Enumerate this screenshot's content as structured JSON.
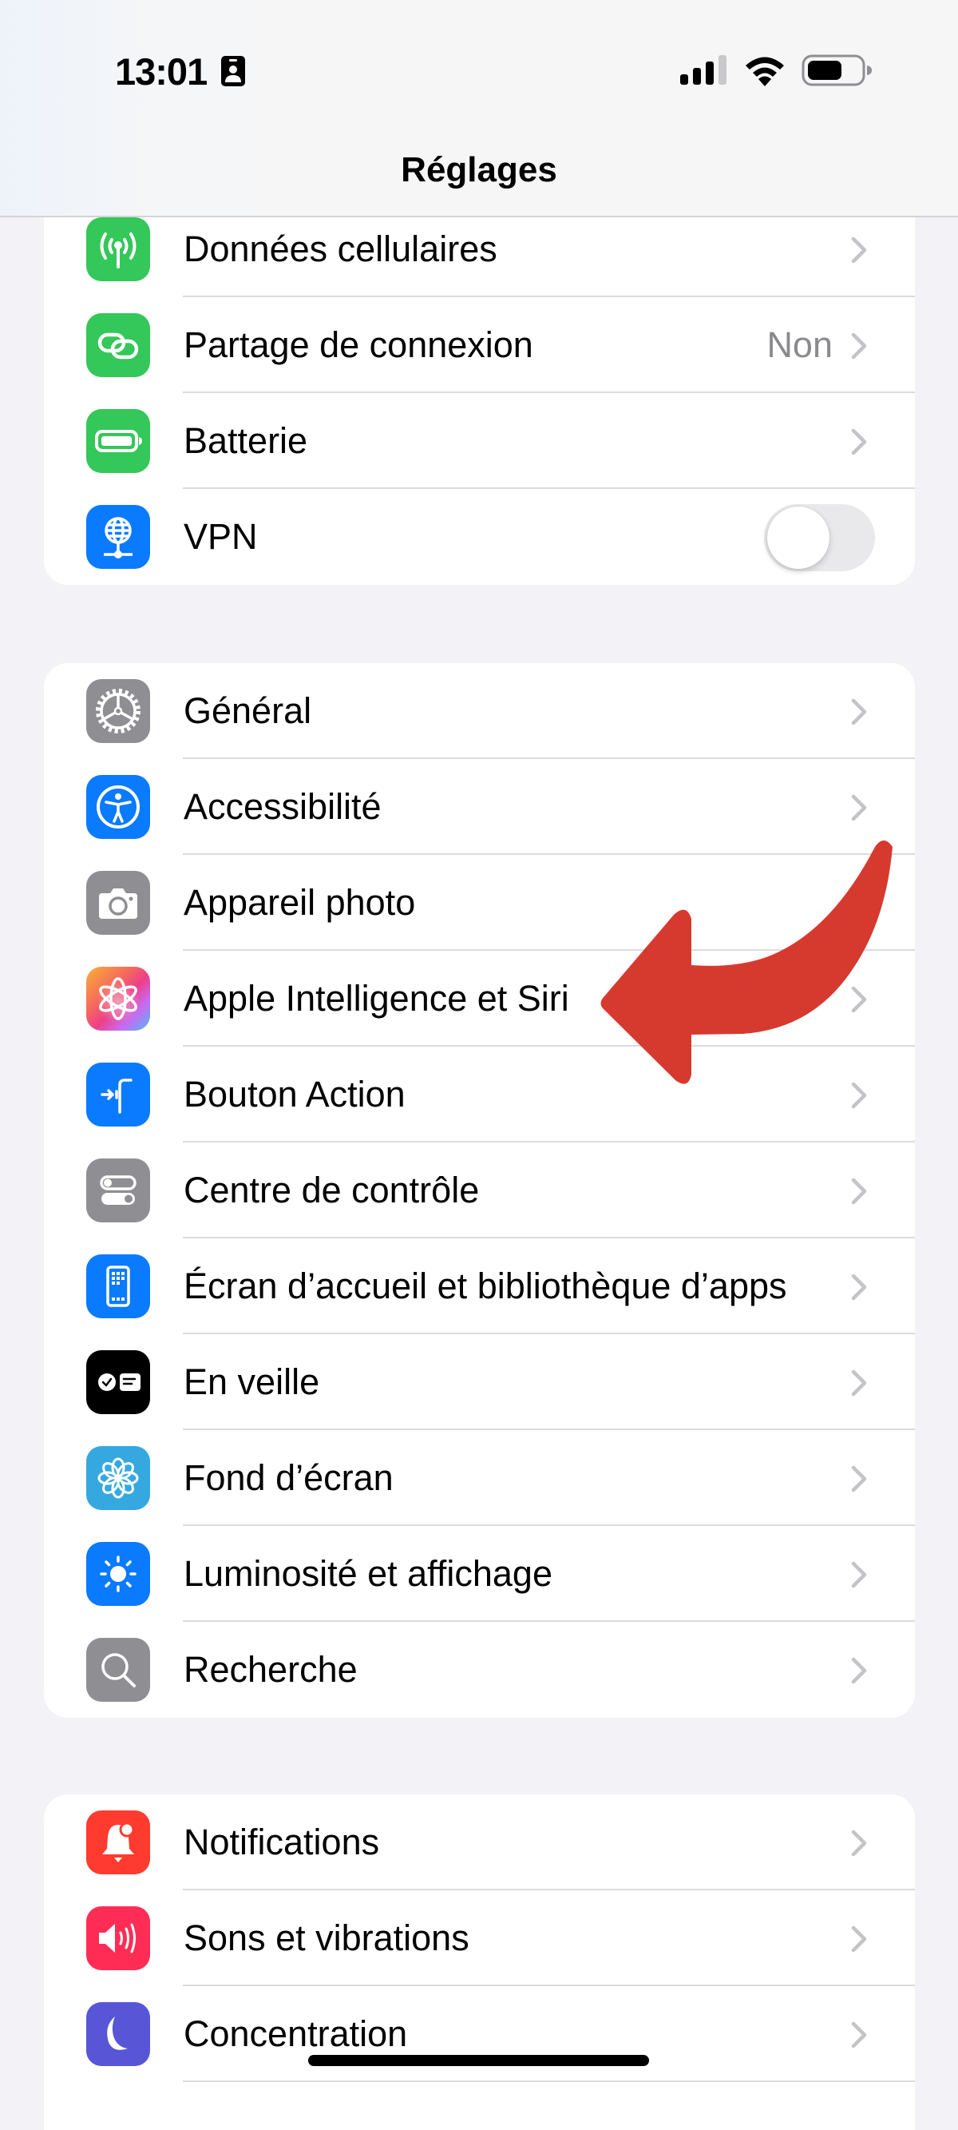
{
  "status_bar": {
    "time": "13:01",
    "status_icon": "id-badge-icon",
    "signal_bars": 3,
    "signal_bars_total": 4,
    "battery_percent": 60
  },
  "header": {
    "title": "Réglages"
  },
  "groups": [
    {
      "rows": [
        {
          "label": "Données cellulaires",
          "icon": "antenna-icon",
          "icon_color": "#34c759",
          "accessory": "chevron"
        },
        {
          "label": "Partage de connexion",
          "icon": "link-icon",
          "icon_color": "#34c759",
          "value": "Non",
          "accessory": "chevron"
        },
        {
          "label": "Batterie",
          "icon": "battery-icon",
          "icon_color": "#34c759",
          "accessory": "chevron"
        },
        {
          "label": "VPN",
          "icon": "globe-network-icon",
          "icon_color": "#0a7aff",
          "accessory": "toggle",
          "toggle_on": false
        }
      ]
    },
    {
      "rows": [
        {
          "label": "Général",
          "icon": "gear-icon",
          "icon_color": "#8e8e93",
          "accessory": "chevron"
        },
        {
          "label": "Accessibilité",
          "icon": "accessibility-icon",
          "icon_color": "#0a7aff",
          "accessory": "chevron"
        },
        {
          "label": "Appareil photo",
          "icon": "camera-icon",
          "icon_color": "#8e8e93",
          "accessory": "chevron"
        },
        {
          "label": "Apple Intelligence et Siri",
          "icon": "apple-intelligence-icon",
          "icon_color": "gradient",
          "accessory": "chevron"
        },
        {
          "label": "Bouton Action",
          "icon": "action-button-icon",
          "icon_color": "#0a7aff",
          "accessory": "chevron"
        },
        {
          "label": "Centre de contrôle",
          "icon": "switches-icon",
          "icon_color": "#8e8e93",
          "accessory": "chevron"
        },
        {
          "label": "Écran d’accueil et bibliothèque d’apps",
          "icon": "home-screen-icon",
          "icon_color": "#0a7aff",
          "accessory": "chevron"
        },
        {
          "label": "En veille",
          "icon": "standby-icon",
          "icon_color": "#000000",
          "accessory": "chevron"
        },
        {
          "label": "Fond d’écran",
          "icon": "flower-icon",
          "icon_color": "#35a8e0",
          "accessory": "chevron"
        },
        {
          "label": "Luminosité et affichage",
          "icon": "sun-icon",
          "icon_color": "#0a7aff",
          "accessory": "chevron"
        },
        {
          "label": "Recherche",
          "icon": "magnifier-icon",
          "icon_color": "#8e8e93",
          "accessory": "chevron"
        }
      ]
    },
    {
      "rows": [
        {
          "label": "Notifications",
          "icon": "bell-icon",
          "icon_color": "#ff3b30",
          "accessory": "chevron"
        },
        {
          "label": "Sons et vibrations",
          "icon": "speaker-icon",
          "icon_color": "#ff2d55",
          "accessory": "chevron"
        },
        {
          "label": "Concentration",
          "icon": "moon-icon",
          "icon_color": "#5856d6",
          "accessory": "chevron"
        }
      ]
    }
  ],
  "annotation": {
    "type": "red-curved-arrow",
    "color": "#d63a2f",
    "points_to": "Apple Intelligence et Siri"
  }
}
